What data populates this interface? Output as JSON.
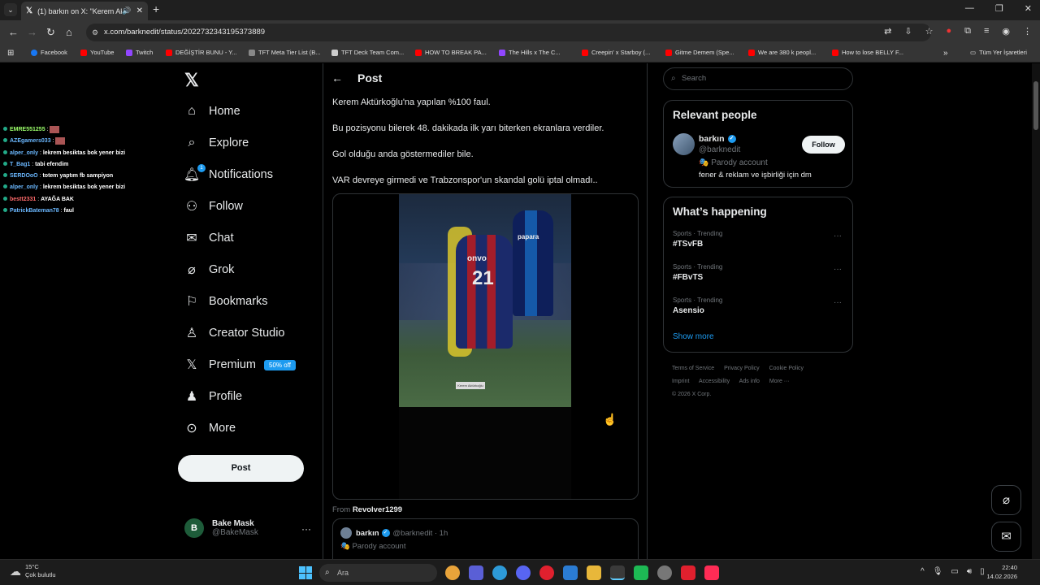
{
  "browser": {
    "tab_title": "(1) barkın on X: \"Kerem Akt",
    "url": "x.com/barknedit/status/2022732343195373889",
    "bookmarks": [
      {
        "label": "Facebook",
        "color": "#1877f2"
      },
      {
        "label": "YouTube",
        "color": "#ff0000"
      },
      {
        "label": "Twitch",
        "color": "#9146ff"
      },
      {
        "label": "DEĞİŞTİR BUNU - Y...",
        "color": "#ff0000"
      },
      {
        "label": "TFT Meta Tier List (B...",
        "color": "#888888"
      },
      {
        "label": "TFT Deck Team Com...",
        "color": "#cccccc"
      },
      {
        "label": "HOW TO BREAK PA...",
        "color": "#ff0000"
      },
      {
        "label": "The Hills x The C...",
        "color": "#9146ff"
      },
      {
        "label": "Creepin' x Starboy (...",
        "color": "#ff0000"
      },
      {
        "label": "Gitme Demem (Spe...",
        "color": "#ff0000"
      },
      {
        "label": "We are 380 k peopl...",
        "color": "#ff0000"
      },
      {
        "label": "How to lose BELLY F...",
        "color": "#ff0000"
      }
    ],
    "all_bookmarks": "Tüm Yer İşaretleri"
  },
  "chat_overlay": [
    {
      "user": "EMRE551255",
      "msg": "",
      "color": "#9cff6b"
    },
    {
      "user": "AZEgamers033",
      "msg": "",
      "color": "#6bb8ff"
    },
    {
      "user": "alper_only",
      "msg": "lekrem besiktas bok yener bizi",
      "color": "#6bb8ff"
    },
    {
      "user": "T_Bag1",
      "msg": "tabi efendim",
      "color": "#6bb8ff"
    },
    {
      "user": "SERDOoO",
      "msg": "totem yaptım fb sampiyon",
      "color": "#6bb8ff"
    },
    {
      "user": "alper_only",
      "msg": "lekrem besiktas bok yener bizi",
      "color": "#6bb8ff"
    },
    {
      "user": "bestt2331",
      "msg": "AYAĞA BAK",
      "color": "#ff6b6b"
    },
    {
      "user": "PatrickBateman78",
      "msg": "faul",
      "color": "#6bb8ff"
    }
  ],
  "nav": {
    "items": [
      "Home",
      "Explore",
      "Notifications",
      "Follow",
      "Chat",
      "Grok",
      "Bookmarks",
      "Creator Studio",
      "Premium",
      "Profile",
      "More"
    ],
    "notification_count": "1",
    "premium_badge": "50% off",
    "post_button": "Post",
    "user_name": "Bake Mask",
    "user_handle": "@BakeMask",
    "user_initial": "B"
  },
  "post": {
    "header": "Post",
    "lines": [
      "Kerem Aktürkoğlu'na yapılan %100 faul.",
      "Bu pozisyonu bilerek 48. dakikada ilk yarı biterken ekranlara verdiler.",
      "Gol olduğu anda göstermediler bile.",
      "VAR devreye girmedi ve Trabzonspor'un skandal golü iptal olmadı.."
    ],
    "video_jersey_number": "21",
    "video_sponsor_1": "onvo",
    "video_sponsor_2": "papara",
    "video_label": "Kerem Aktürkoğlu",
    "from_prefix": "From",
    "from_user": "Revolver1299",
    "quote_name": "barkın",
    "quote_handle": "@barknedit · 1h",
    "quote_parody": "🎭 Parody account"
  },
  "sidebar": {
    "search_placeholder": "Search",
    "relevant_title": "Relevant people",
    "person_name": "barkın",
    "person_handle": "@barknedit",
    "person_parody": "🎭 Parody account",
    "person_bio": "fener & reklam ve işbirliği için dm",
    "follow_label": "Follow",
    "happening_title": "What’s happening",
    "trends": [
      {
        "category": "Sports · Trending",
        "name": "#TSvFB"
      },
      {
        "category": "Sports · Trending",
        "name": "#FBvTS"
      },
      {
        "category": "Sports · Trending",
        "name": "Asensio"
      }
    ],
    "show_more": "Show more",
    "footer_links": [
      "Terms of Service",
      "Privacy Policy",
      "Cookie Policy",
      "Imprint",
      "Accessibility",
      "Ads info",
      "More ···"
    ],
    "copyright": "© 2026 X Corp."
  },
  "taskbar": {
    "temperature": "15°C",
    "weather": "Çok bulutlu",
    "search": "Ara",
    "time": "22:40",
    "date": "14.02.2026"
  }
}
